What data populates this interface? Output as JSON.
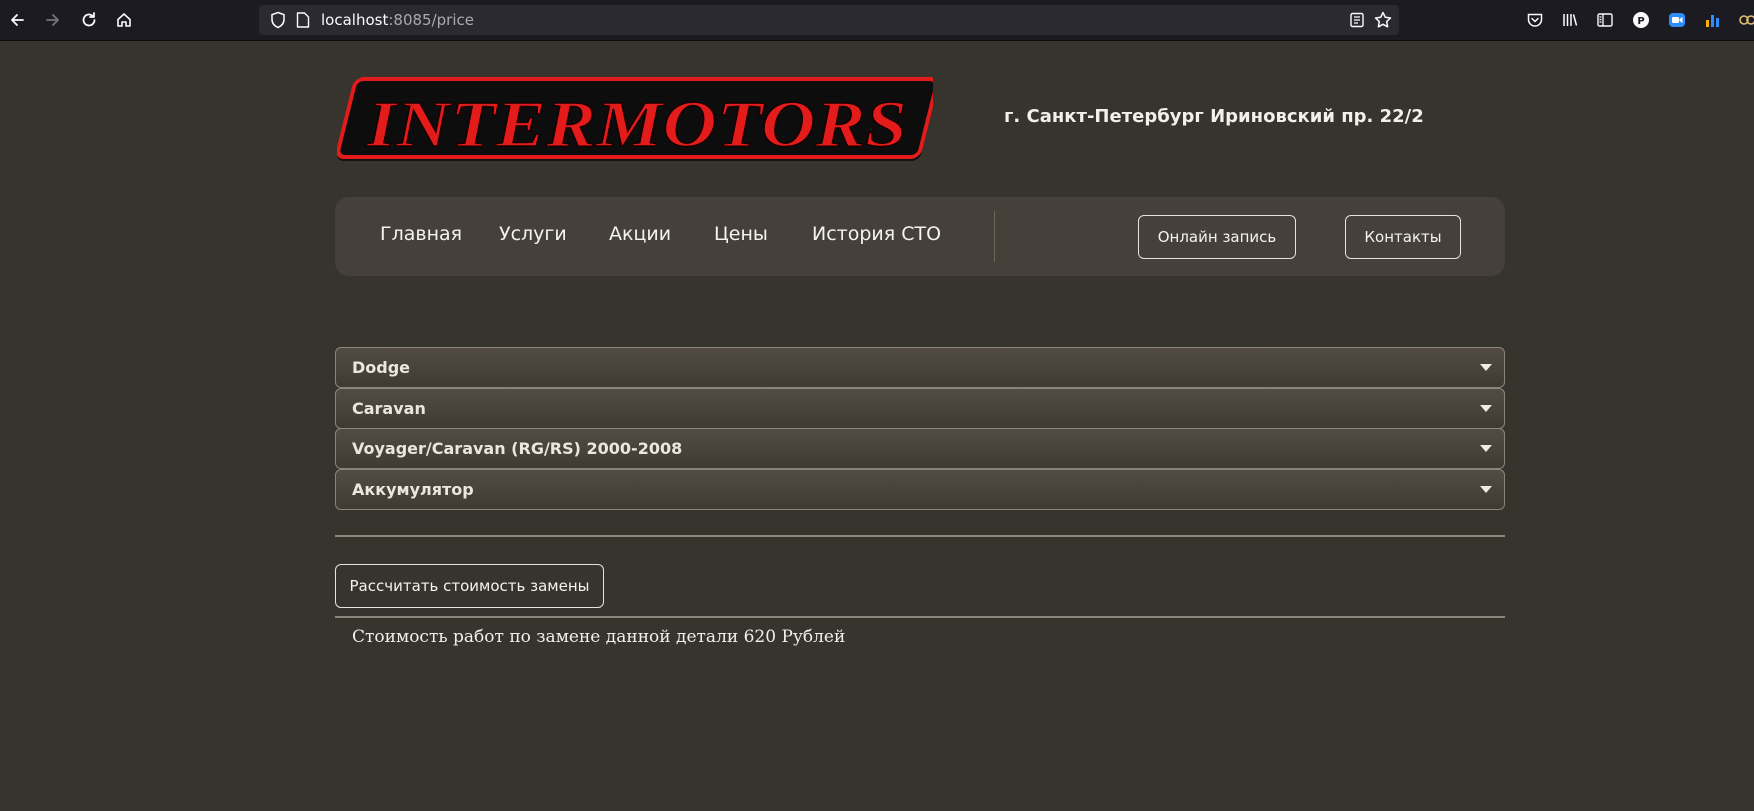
{
  "browser": {
    "url_host": "localhost",
    "url_path": ":8085/price",
    "icons": [
      "back-icon",
      "forward-icon",
      "reload-icon",
      "home-icon",
      "shield-icon",
      "page-icon",
      "reader-view-icon",
      "bookmark-star-icon",
      "pocket-icon",
      "library-icon",
      "sidebar-icon",
      "profile-icon",
      "zoom-extension-icon",
      "stats-extension-icon",
      "extension-icon"
    ]
  },
  "header": {
    "logo_text": "INTERMOTORS",
    "address": "г. Санкт-Петербург Ириновский пр. 22/2"
  },
  "nav": {
    "links": [
      "Главная",
      "Услуги",
      "Акции",
      "Цены",
      "История СТО"
    ],
    "online_button": "Онлайн запись",
    "contacts_button": "Контакты"
  },
  "selects": [
    {
      "value": "Dodge"
    },
    {
      "value": "Caravan"
    },
    {
      "value": "Voyager/Caravan (RG/RS) 2000-2008"
    },
    {
      "value": "Аккумулятор"
    }
  ],
  "calculate_button": "Рассчитать стоимость замены",
  "result_text": "Стоимость работ по замене данной детали 620 Рублей",
  "colors": {
    "page_bg": "#37332d",
    "nav_bg": "#45413a",
    "logo_red": "#e31b1b",
    "text": "#f5f3ee"
  }
}
